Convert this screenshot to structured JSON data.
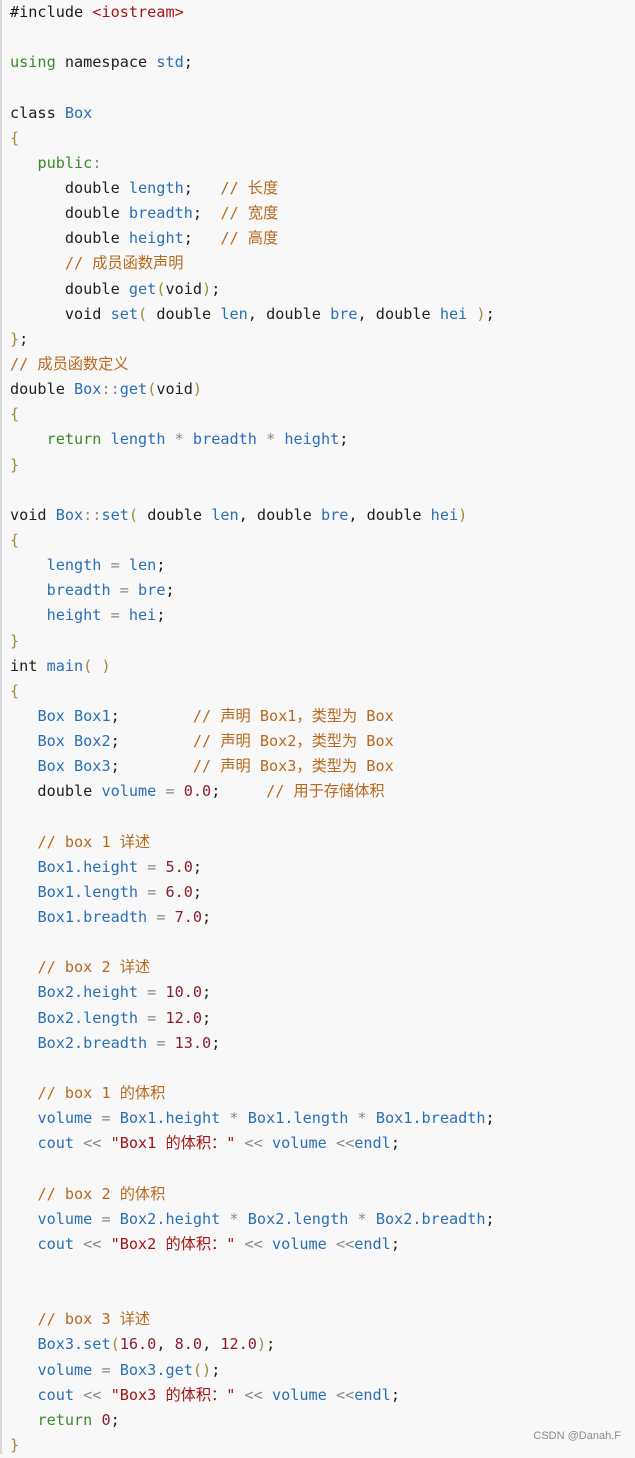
{
  "code": {
    "language": "cpp",
    "lines": [
      [
        [
          "kw",
          "#include "
        ],
        [
          "str",
          "<iostream>"
        ]
      ],
      [],
      [
        [
          "kw2",
          "using"
        ],
        [
          "plain",
          " namespace "
        ],
        [
          "id",
          "std"
        ],
        [
          "plain",
          ";"
        ]
      ],
      [],
      [
        [
          "kw",
          "class "
        ],
        [
          "id",
          "Box"
        ]
      ],
      [
        [
          "punc",
          "{"
        ]
      ],
      [
        [
          "plain",
          "   "
        ],
        [
          "kw2",
          "public"
        ],
        [
          "op",
          ":"
        ]
      ],
      [
        [
          "plain",
          "      double "
        ],
        [
          "id",
          "length"
        ],
        [
          "plain",
          ";   "
        ],
        [
          "cm",
          "// 长度"
        ]
      ],
      [
        [
          "plain",
          "      double "
        ],
        [
          "id",
          "breadth"
        ],
        [
          "plain",
          ";  "
        ],
        [
          "cm",
          "// 宽度"
        ]
      ],
      [
        [
          "plain",
          "      double "
        ],
        [
          "id",
          "height"
        ],
        [
          "plain",
          ";   "
        ],
        [
          "cm",
          "// 高度"
        ]
      ],
      [
        [
          "plain",
          "      "
        ],
        [
          "cm",
          "// 成员函数声明"
        ]
      ],
      [
        [
          "plain",
          "      double "
        ],
        [
          "id",
          "get"
        ],
        [
          "punc",
          "("
        ],
        [
          "plain",
          "void"
        ],
        [
          "punc",
          ")"
        ],
        [
          "plain",
          ";"
        ]
      ],
      [
        [
          "plain",
          "      void "
        ],
        [
          "id",
          "set"
        ],
        [
          "punc",
          "("
        ],
        [
          "plain",
          " double "
        ],
        [
          "id",
          "len"
        ],
        [
          "plain",
          ", double "
        ],
        [
          "id",
          "bre"
        ],
        [
          "plain",
          ", double "
        ],
        [
          "id",
          "hei"
        ],
        [
          "plain",
          " "
        ],
        [
          "punc",
          ")"
        ],
        [
          "plain",
          ";"
        ]
      ],
      [
        [
          "punc",
          "}"
        ],
        [
          "plain",
          ";"
        ]
      ],
      [
        [
          "cm",
          "// 成员函数定义"
        ]
      ],
      [
        [
          "plain",
          "double "
        ],
        [
          "id",
          "Box"
        ],
        [
          "op",
          "::"
        ],
        [
          "id",
          "get"
        ],
        [
          "punc",
          "("
        ],
        [
          "plain",
          "void"
        ],
        [
          "punc",
          ")"
        ]
      ],
      [
        [
          "punc",
          "{"
        ]
      ],
      [
        [
          "plain",
          "    "
        ],
        [
          "kw2",
          "return"
        ],
        [
          "plain",
          " "
        ],
        [
          "id",
          "length"
        ],
        [
          "op",
          " * "
        ],
        [
          "id",
          "breadth"
        ],
        [
          "op",
          " * "
        ],
        [
          "id",
          "height"
        ],
        [
          "plain",
          ";"
        ]
      ],
      [
        [
          "punc",
          "}"
        ]
      ],
      [],
      [
        [
          "plain",
          "void "
        ],
        [
          "id",
          "Box"
        ],
        [
          "op",
          "::"
        ],
        [
          "id",
          "set"
        ],
        [
          "punc",
          "("
        ],
        [
          "plain",
          " double "
        ],
        [
          "id",
          "len"
        ],
        [
          "plain",
          ", double "
        ],
        [
          "id",
          "bre"
        ],
        [
          "plain",
          ", double "
        ],
        [
          "id",
          "hei"
        ],
        [
          "punc",
          ")"
        ]
      ],
      [
        [
          "punc",
          "{"
        ]
      ],
      [
        [
          "plain",
          "    "
        ],
        [
          "id",
          "length"
        ],
        [
          "op",
          " = "
        ],
        [
          "id",
          "len"
        ],
        [
          "plain",
          ";"
        ]
      ],
      [
        [
          "plain",
          "    "
        ],
        [
          "id",
          "breadth"
        ],
        [
          "op",
          " = "
        ],
        [
          "id",
          "bre"
        ],
        [
          "plain",
          ";"
        ]
      ],
      [
        [
          "plain",
          "    "
        ],
        [
          "id",
          "height"
        ],
        [
          "op",
          " = "
        ],
        [
          "id",
          "hei"
        ],
        [
          "plain",
          ";"
        ]
      ],
      [
        [
          "punc",
          "}"
        ]
      ],
      [
        [
          "plain",
          "int "
        ],
        [
          "id",
          "main"
        ],
        [
          "punc",
          "("
        ],
        [
          "plain",
          " "
        ],
        [
          "punc",
          ")"
        ]
      ],
      [
        [
          "punc",
          "{"
        ]
      ],
      [
        [
          "plain",
          "   "
        ],
        [
          "id",
          "Box Box1"
        ],
        [
          "plain",
          ";        "
        ],
        [
          "cm",
          "// 声明 Box1，类型为 Box"
        ]
      ],
      [
        [
          "plain",
          "   "
        ],
        [
          "id",
          "Box Box2"
        ],
        [
          "plain",
          ";        "
        ],
        [
          "cm",
          "// 声明 Box2，类型为 Box"
        ]
      ],
      [
        [
          "plain",
          "   "
        ],
        [
          "id",
          "Box Box3"
        ],
        [
          "plain",
          ";        "
        ],
        [
          "cm",
          "// 声明 Box3，类型为 Box"
        ]
      ],
      [
        [
          "plain",
          "   double "
        ],
        [
          "id",
          "volume"
        ],
        [
          "op",
          " = "
        ],
        [
          "num",
          "0.0"
        ],
        [
          "plain",
          ";     "
        ],
        [
          "cm",
          "// 用于存储体积"
        ]
      ],
      [],
      [
        [
          "plain",
          "   "
        ],
        [
          "cm",
          "// box 1 详述"
        ]
      ],
      [
        [
          "plain",
          "   "
        ],
        [
          "id",
          "Box1.height"
        ],
        [
          "op",
          " = "
        ],
        [
          "num",
          "5.0"
        ],
        [
          "plain",
          ";"
        ]
      ],
      [
        [
          "plain",
          "   "
        ],
        [
          "id",
          "Box1.length"
        ],
        [
          "op",
          " = "
        ],
        [
          "num",
          "6.0"
        ],
        [
          "plain",
          ";"
        ]
      ],
      [
        [
          "plain",
          "   "
        ],
        [
          "id",
          "Box1.breadth"
        ],
        [
          "op",
          " = "
        ],
        [
          "num",
          "7.0"
        ],
        [
          "plain",
          ";"
        ]
      ],
      [],
      [
        [
          "plain",
          "   "
        ],
        [
          "cm",
          "// box 2 详述"
        ]
      ],
      [
        [
          "plain",
          "   "
        ],
        [
          "id",
          "Box2.height"
        ],
        [
          "op",
          " = "
        ],
        [
          "num",
          "10.0"
        ],
        [
          "plain",
          ";"
        ]
      ],
      [
        [
          "plain",
          "   "
        ],
        [
          "id",
          "Box2.length"
        ],
        [
          "op",
          " = "
        ],
        [
          "num",
          "12.0"
        ],
        [
          "plain",
          ";"
        ]
      ],
      [
        [
          "plain",
          "   "
        ],
        [
          "id",
          "Box2.breadth"
        ],
        [
          "op",
          " = "
        ],
        [
          "num",
          "13.0"
        ],
        [
          "plain",
          ";"
        ]
      ],
      [],
      [
        [
          "plain",
          "   "
        ],
        [
          "cm",
          "// box 1 的体积"
        ]
      ],
      [
        [
          "plain",
          "   "
        ],
        [
          "id",
          "volume"
        ],
        [
          "op",
          " = "
        ],
        [
          "id",
          "Box1.height"
        ],
        [
          "op",
          " * "
        ],
        [
          "id",
          "Box1.length"
        ],
        [
          "op",
          " * "
        ],
        [
          "id",
          "Box1.breadth"
        ],
        [
          "plain",
          ";"
        ]
      ],
      [
        [
          "plain",
          "   "
        ],
        [
          "id",
          "cout"
        ],
        [
          "op",
          " << "
        ],
        [
          "str",
          "\"Box1 的体积：\""
        ],
        [
          "op",
          " << "
        ],
        [
          "id",
          "volume"
        ],
        [
          "op",
          " <<"
        ],
        [
          "id",
          "endl"
        ],
        [
          "plain",
          ";"
        ]
      ],
      [],
      [
        [
          "plain",
          "   "
        ],
        [
          "cm",
          "// box 2 的体积"
        ]
      ],
      [
        [
          "plain",
          "   "
        ],
        [
          "id",
          "volume"
        ],
        [
          "op",
          " = "
        ],
        [
          "id",
          "Box2.height"
        ],
        [
          "op",
          " * "
        ],
        [
          "id",
          "Box2.length"
        ],
        [
          "op",
          " * "
        ],
        [
          "id",
          "Box2.breadth"
        ],
        [
          "plain",
          ";"
        ]
      ],
      [
        [
          "plain",
          "   "
        ],
        [
          "id",
          "cout"
        ],
        [
          "op",
          " << "
        ],
        [
          "str",
          "\"Box2 的体积：\""
        ],
        [
          "op",
          " << "
        ],
        [
          "id",
          "volume"
        ],
        [
          "op",
          " <<"
        ],
        [
          "id",
          "endl"
        ],
        [
          "plain",
          ";"
        ]
      ],
      [],
      [],
      [
        [
          "plain",
          "   "
        ],
        [
          "cm",
          "// box 3 详述"
        ]
      ],
      [
        [
          "plain",
          "   "
        ],
        [
          "id",
          "Box3.set"
        ],
        [
          "punc",
          "("
        ],
        [
          "num",
          "16.0"
        ],
        [
          "plain",
          ", "
        ],
        [
          "num",
          "8.0"
        ],
        [
          "plain",
          ", "
        ],
        [
          "num",
          "12.0"
        ],
        [
          "punc",
          ")"
        ],
        [
          "plain",
          ";"
        ]
      ],
      [
        [
          "plain",
          "   "
        ],
        [
          "id",
          "volume"
        ],
        [
          "op",
          " = "
        ],
        [
          "id",
          "Box3.get"
        ],
        [
          "punc",
          "()"
        ],
        [
          "plain",
          ";"
        ]
      ],
      [
        [
          "plain",
          "   "
        ],
        [
          "id",
          "cout"
        ],
        [
          "op",
          " << "
        ],
        [
          "str",
          "\"Box3 的体积：\""
        ],
        [
          "op",
          " << "
        ],
        [
          "id",
          "volume"
        ],
        [
          "op",
          " <<"
        ],
        [
          "id",
          "endl"
        ],
        [
          "plain",
          ";"
        ]
      ],
      [
        [
          "plain",
          "   "
        ],
        [
          "kw2",
          "return"
        ],
        [
          "plain",
          " "
        ],
        [
          "num",
          "0"
        ],
        [
          "plain",
          ";"
        ]
      ],
      [
        [
          "punc",
          "}"
        ]
      ]
    ]
  },
  "watermark": "CSDN @Danah.F"
}
